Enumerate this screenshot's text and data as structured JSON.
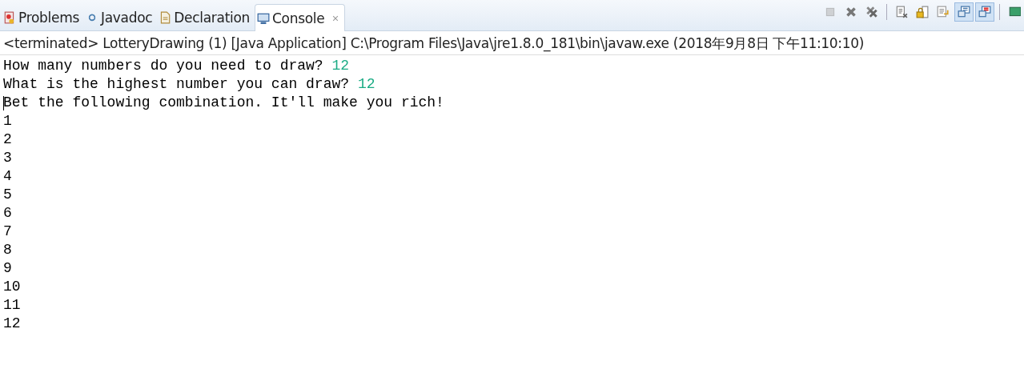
{
  "tabs": [
    {
      "label": "Problems",
      "selected": false
    },
    {
      "label": "Javadoc",
      "selected": false
    },
    {
      "label": "Declaration",
      "selected": false
    },
    {
      "label": "Console",
      "selected": true
    }
  ],
  "toolbar": [
    {
      "kind": "stop",
      "disabled": true,
      "on": false
    },
    {
      "kind": "remove",
      "disabled": false,
      "on": false
    },
    {
      "kind": "remove-all",
      "disabled": false,
      "on": false
    },
    {
      "kind": "sep"
    },
    {
      "kind": "clear",
      "disabled": false,
      "on": false
    },
    {
      "kind": "lock",
      "disabled": false,
      "on": false
    },
    {
      "kind": "wrap",
      "disabled": false,
      "on": false
    },
    {
      "kind": "show-out",
      "disabled": false,
      "on": true
    },
    {
      "kind": "show-err",
      "disabled": false,
      "on": true
    },
    {
      "kind": "sep"
    },
    {
      "kind": "open",
      "disabled": false,
      "on": false
    }
  ],
  "console": {
    "header": "<terminated> LotteryDrawing (1) [Java Application] C:\\Program Files\\Java\\jre1.8.0_181\\bin\\javaw.exe (2018年9月8日 下午11:10:10)",
    "lines": [
      {
        "kind": "prompt",
        "text": "How many numbers do you need to draw? ",
        "input": "12"
      },
      {
        "kind": "prompt",
        "text": "What is the highest number you can draw? ",
        "input": "12"
      },
      {
        "kind": "output",
        "text": "Bet the following combination. It'll make you rich!",
        "caret": true
      },
      {
        "kind": "output",
        "text": "1"
      },
      {
        "kind": "output",
        "text": "2"
      },
      {
        "kind": "output",
        "text": "3"
      },
      {
        "kind": "output",
        "text": "4"
      },
      {
        "kind": "output",
        "text": "5"
      },
      {
        "kind": "output",
        "text": "6"
      },
      {
        "kind": "output",
        "text": "7"
      },
      {
        "kind": "output",
        "text": "8"
      },
      {
        "kind": "output",
        "text": "9"
      },
      {
        "kind": "output",
        "text": "10"
      },
      {
        "kind": "output",
        "text": "11"
      },
      {
        "kind": "output",
        "text": "12"
      }
    ]
  }
}
